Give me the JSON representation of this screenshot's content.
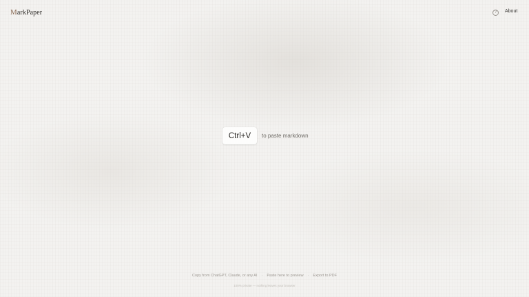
{
  "header": {
    "logo_initial": "M",
    "logo_rest": "arkPaper",
    "help_icon_glyph": "?",
    "about_label": "About"
  },
  "main": {
    "shortcut_label": "Ctrl+V",
    "hint_text": "to paste markdown"
  },
  "footer": {
    "steps": [
      "Copy from ChatGPT, Claude, or any AI",
      "Paste here to preview",
      "Export to PDF"
    ],
    "separator": "·",
    "privacy_note": "100% private — nothing leaves your browser"
  },
  "colors": {
    "background": "#f3f2f0",
    "logo_initial_accent": "#8a6a55",
    "key_background": "#fdfdfc"
  },
  "icons": {
    "help": "help-circle-icon"
  }
}
